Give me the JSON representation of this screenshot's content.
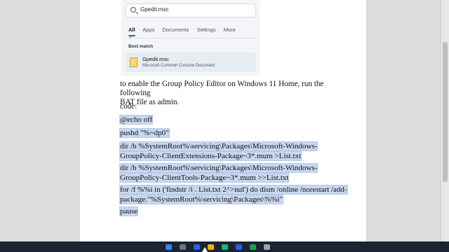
{
  "search_panel": {
    "query": "Gpedit.msc",
    "filters": [
      "All",
      "Apps",
      "Documents",
      "Settings",
      "More"
    ],
    "best_match_label": "Best match",
    "result_title": "Gpedit.msc",
    "result_subtitle": "Microsoft Common Console Document"
  },
  "article": {
    "intro_line1": "to enable the Group Policy Editor on Windows 11 Home, run the following",
    "intro_line2": "BAT  file as admin.",
    "code_label": "code:",
    "code_lines": [
      [
        "@echo off"
      ],
      [
        "pushd \"%~dp0\""
      ],
      [
        "dir /b %SystemRoot%\\servicing\\Packages\\Microsoft-Windows-",
        "GroupPolicy-ClientExtensions-Package~3*.mum >List.txt"
      ],
      [
        "dir /b %SystemRoot%\\servicing\\Packages\\Microsoft-Windows-",
        "GroupPolicy-ClientTools-Package~3*.mum >>List.txt"
      ],
      [
        "for /f %%i in ('findstr /i . List.txt 2^>nul') do dism /online /norestart /add-",
        "package:\"%SystemRoot%\\servicing\\Packages\\%%i\""
      ],
      [
        "pause"
      ]
    ]
  },
  "colors": {
    "selection": "#c8d7ef",
    "taskbar": "#1c2433"
  }
}
